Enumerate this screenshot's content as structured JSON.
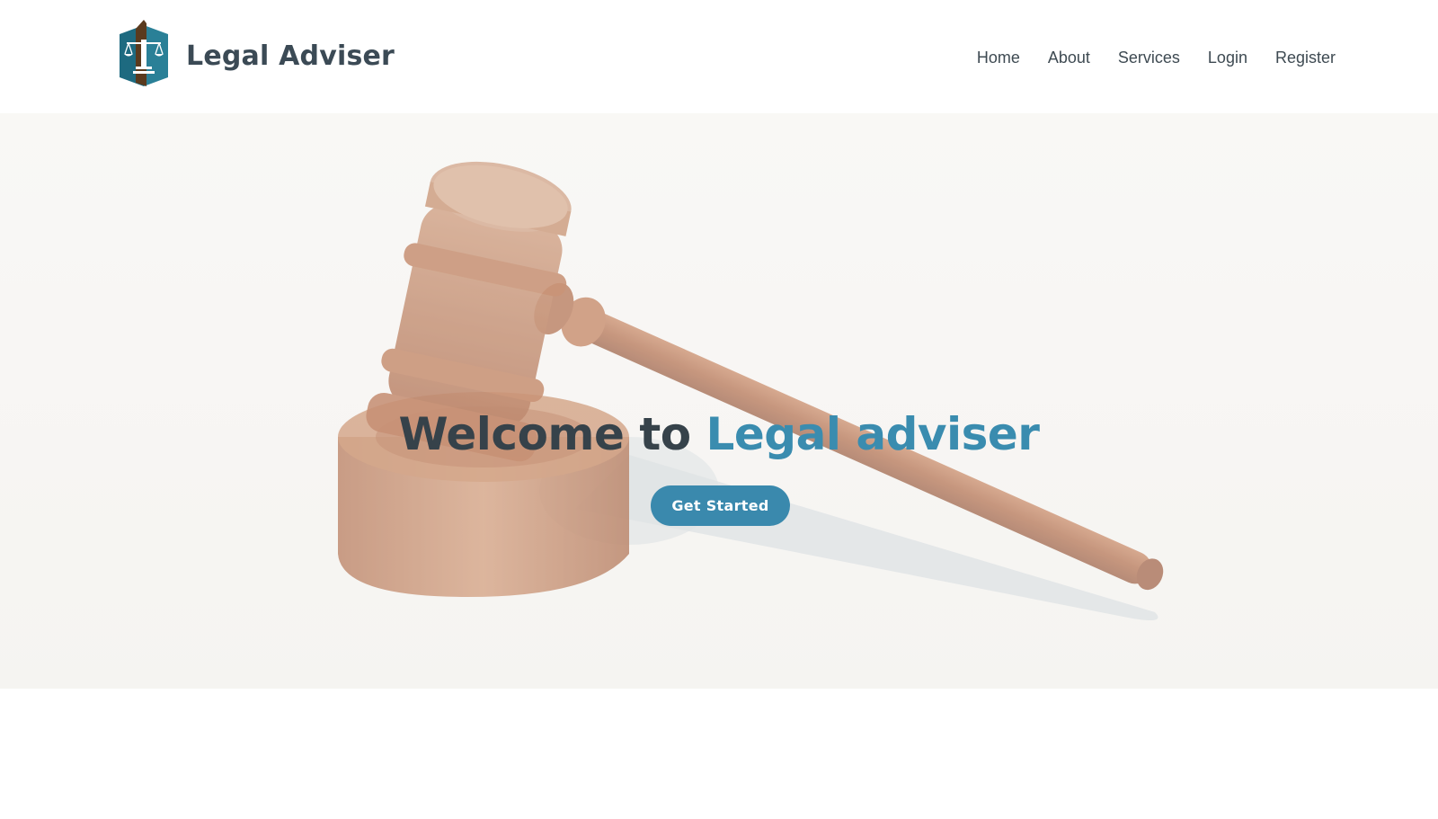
{
  "header": {
    "brand_name": "Legal Adviser",
    "logo_icon": "scales-of-justice-building-icon",
    "nav": [
      {
        "label": "Home"
      },
      {
        "label": "About"
      },
      {
        "label": "Services"
      },
      {
        "label": "Login"
      },
      {
        "label": "Register"
      }
    ]
  },
  "hero": {
    "title_prefix": "Welcome to",
    "title_accent": "Legal adviser",
    "cta_label": "Get Started",
    "background_image": "judge-gavel-on-sound-block"
  },
  "colors": {
    "brand_dark": "#3b4a55",
    "accent": "#3a89ad",
    "logo_teal": "#1f6f86",
    "logo_brown": "#5b3b1f",
    "gavel_wood": "#b0623a"
  }
}
